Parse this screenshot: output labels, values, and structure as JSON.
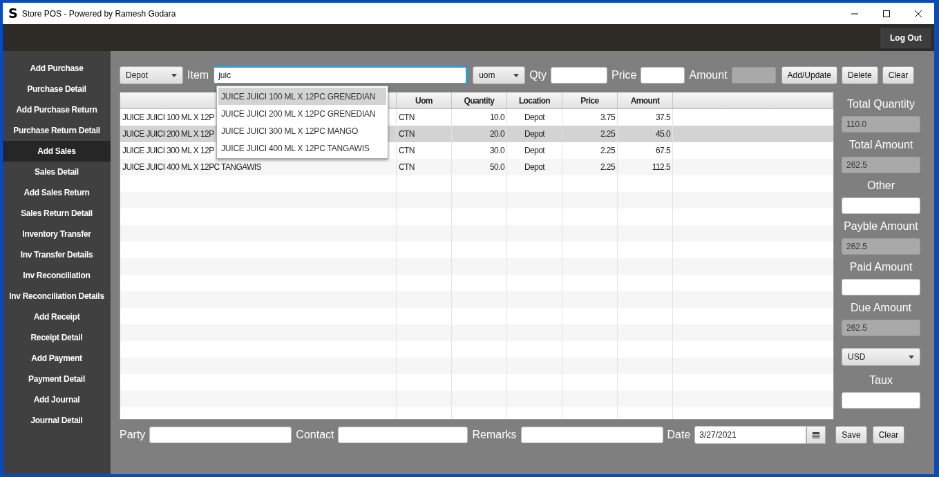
{
  "window": {
    "logo": "S",
    "title": "Store POS - Powered by Ramesh Godara"
  },
  "header": {
    "logout": "Log Out"
  },
  "sidebar": {
    "items": [
      {
        "label": "Add Purchase",
        "selected": false
      },
      {
        "label": "Purchase Detail",
        "selected": false
      },
      {
        "label": "Add Purchase Return",
        "selected": false
      },
      {
        "label": "Purchase Return Detail",
        "selected": false
      },
      {
        "label": "Add Sales",
        "selected": true
      },
      {
        "label": "Sales Detail",
        "selected": false
      },
      {
        "label": "Add Sales Return",
        "selected": false
      },
      {
        "label": "Sales Return Detail",
        "selected": false
      },
      {
        "label": "Inventory Transfer",
        "selected": false
      },
      {
        "label": "Inv Transfer Details",
        "selected": false
      },
      {
        "label": "Inv Reconciliation",
        "selected": false
      },
      {
        "label": "Inv Reconciliation Details",
        "selected": false
      },
      {
        "label": "Add Receipt",
        "selected": false
      },
      {
        "label": "Receipt Detail",
        "selected": false
      },
      {
        "label": "Add Payment",
        "selected": false
      },
      {
        "label": "Payment Detail",
        "selected": false
      },
      {
        "label": "Add Journal",
        "selected": false
      },
      {
        "label": "Journal Detail",
        "selected": false
      }
    ]
  },
  "toolbar": {
    "location_select": "Depot",
    "item_label": "Item",
    "item_value": "juic",
    "uom_select": "uom",
    "qty_label": "Qty",
    "price_label": "Price",
    "amount_label": "Amount",
    "buttons": [
      "Add/Update",
      "Delete",
      "Clear"
    ]
  },
  "suggestions": [
    {
      "label": "JUICE JUICI 100 ML X 12PC GRENEDIAN",
      "selected": true
    },
    {
      "label": "JUICE JUICI 200 ML X 12PC GRENEDIAN",
      "selected": false
    },
    {
      "label": "JUICE JUICI 300 ML X 12PC MANGO",
      "selected": false
    },
    {
      "label": "JUICE JUICI 400 ML X 12PC TANGAWIS",
      "selected": false
    }
  ],
  "table": {
    "columns": [
      "Uom",
      "Quantity",
      "Location",
      "Price",
      "Amount"
    ],
    "rows": [
      {
        "item": "JUICE JUICI 100 ML X 12P",
        "uom": "CTN",
        "quantity": "10.0",
        "location": "Depot",
        "price": "3.75",
        "amount": "37.5",
        "selected": false
      },
      {
        "item": "JUICE JUICI 200 ML X 12P",
        "uom": "CTN",
        "quantity": "20.0",
        "location": "Depot",
        "price": "2.25",
        "amount": "45.0",
        "selected": true
      },
      {
        "item": "JUICE JUICI 300 ML X 12P",
        "uom": "CTN",
        "quantity": "30.0",
        "location": "Depot",
        "price": "2.25",
        "amount": "67.5",
        "selected": false
      },
      {
        "item": "JUICE JUICI 400 ML X 12PC TANGAWIS",
        "uom": "CTN",
        "quantity": "50.0",
        "location": "Depot",
        "price": "2.25",
        "amount": "112.5",
        "selected": false
      }
    ]
  },
  "summary": [
    {
      "label": "Total Quantity",
      "value": "110.0",
      "readonly": true
    },
    {
      "label": "Total Amount",
      "value": "262.5",
      "readonly": true
    },
    {
      "label": "Other",
      "readonly": false
    },
    {
      "label": "Payble Amount",
      "value": "262.5",
      "readonly": true
    },
    {
      "label": "Paid Amount",
      "readonly": false
    },
    {
      "label": "Due Amount",
      "value": "262.5",
      "readonly": true
    }
  ],
  "currency": {
    "value": "USD",
    "rate_label": "Taux"
  },
  "footer": {
    "party_label": "Party",
    "contact_label": "Contact",
    "remarks_label": "Remarks",
    "date_label": "Date",
    "date_value": "3/27/2021",
    "buttons": [
      "Save",
      "Clear"
    ]
  }
}
